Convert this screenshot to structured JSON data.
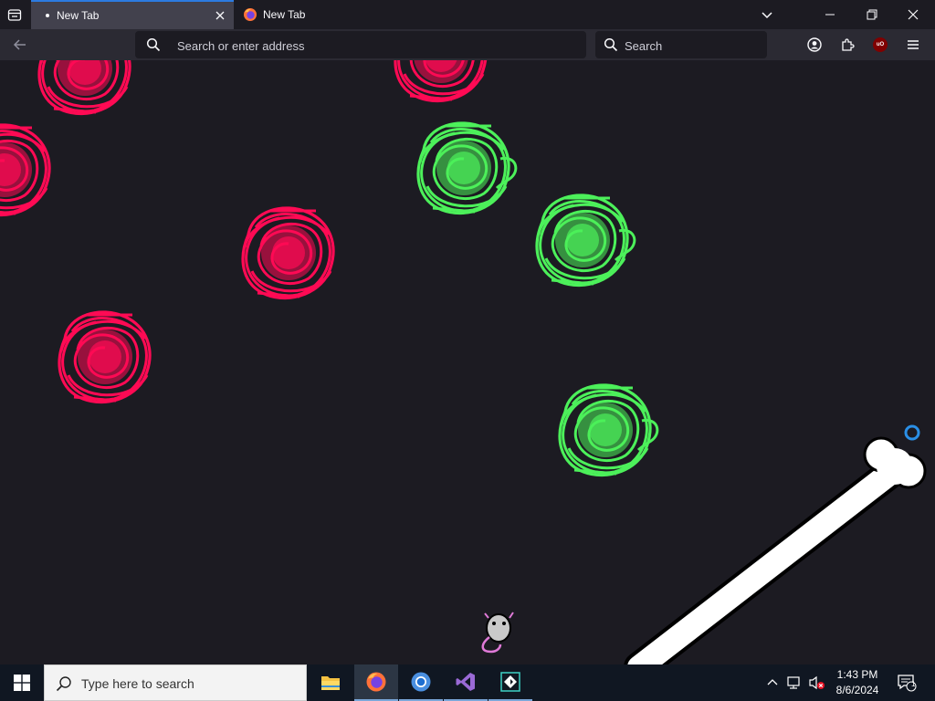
{
  "browser": {
    "tabs": [
      {
        "label": "New Tab",
        "active": true
      },
      {
        "label": "New Tab",
        "active": false
      }
    ],
    "address_placeholder": "Search or enter address",
    "search_placeholder": "Search",
    "accent_color": "#2c7be0"
  },
  "page": {
    "background_color": "#1c1b22",
    "blob_colors": {
      "red": "#ff0a54",
      "green": "#4cf05a"
    }
  },
  "taskbar": {
    "search_placeholder": "Type here to search",
    "apps": [
      "file-explorer",
      "firefox",
      "chromium",
      "visual-studio",
      "dev-app"
    ],
    "time": "1:43 PM",
    "date": "8/6/2024",
    "notification_count": "1"
  }
}
